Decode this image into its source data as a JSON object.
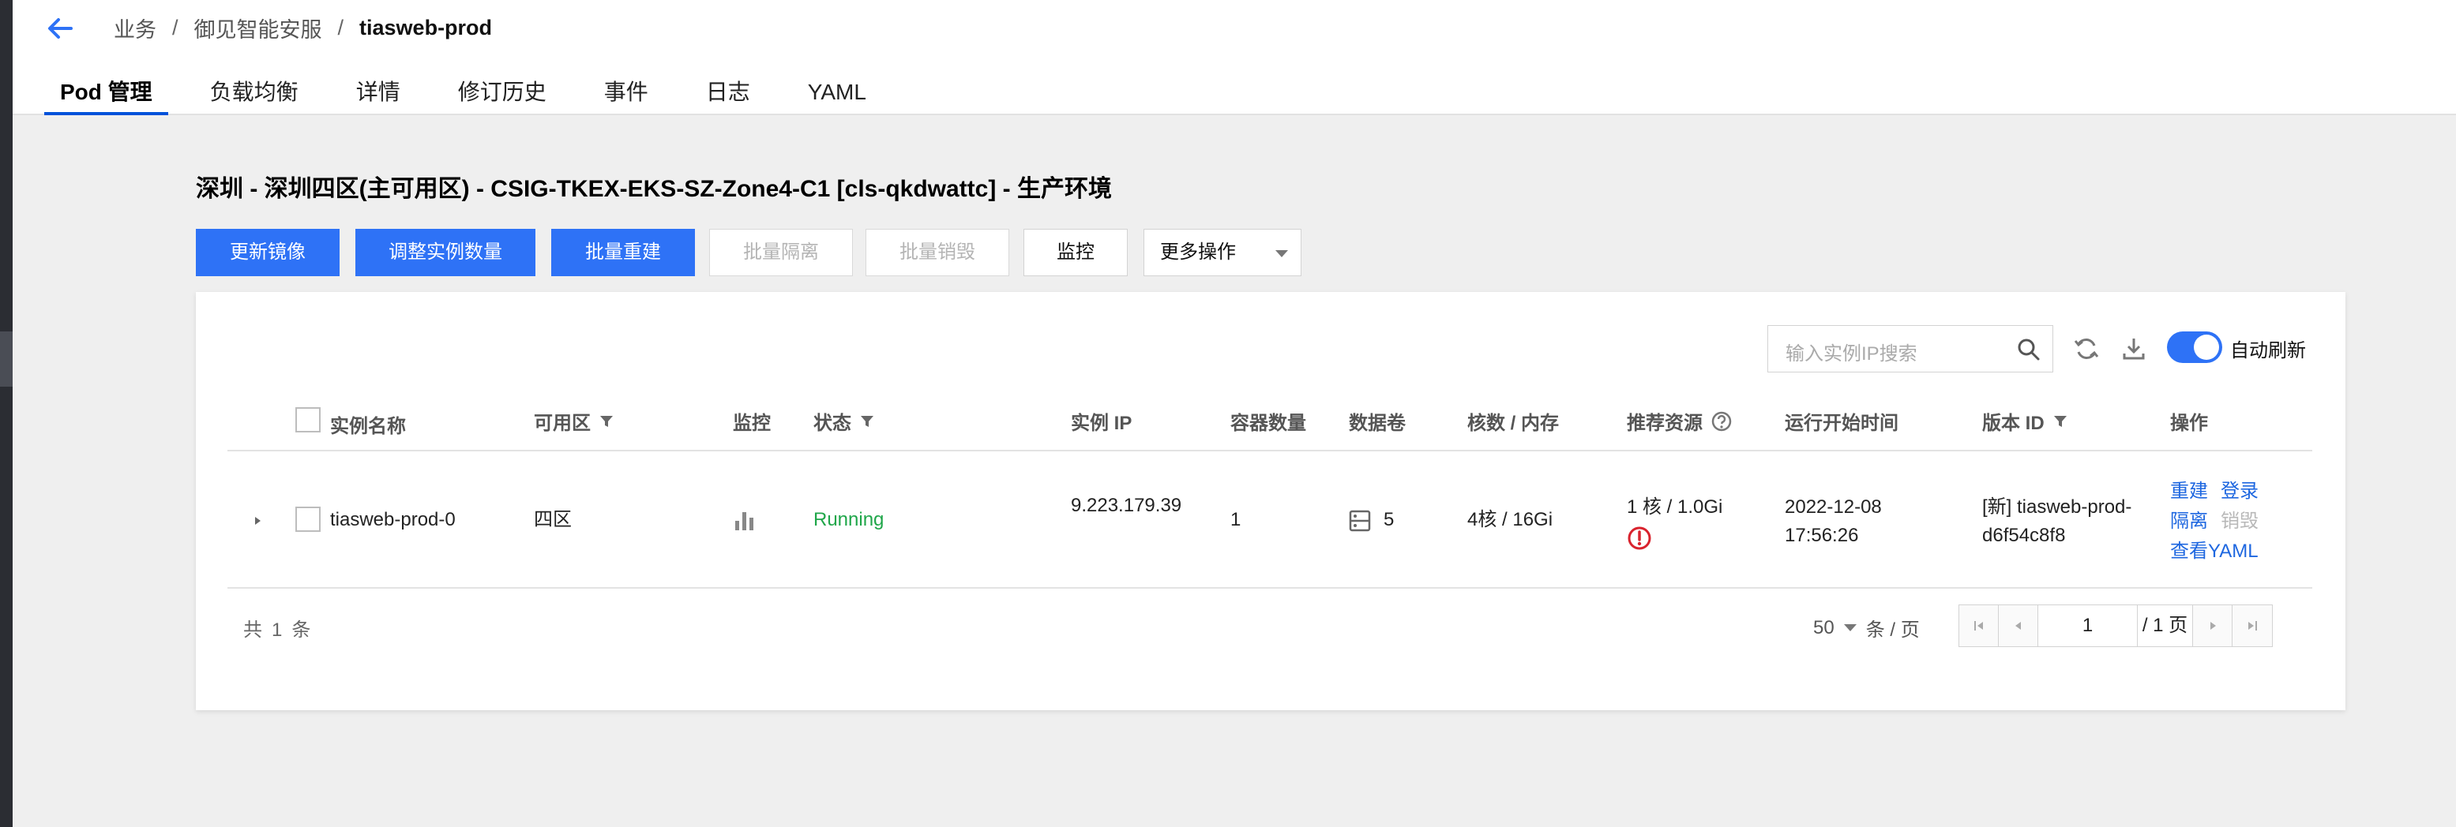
{
  "breadcrumb": {
    "root": "业务",
    "sep": "/",
    "business": "御见智能安服",
    "current": "tiasweb-prod"
  },
  "tabs": [
    {
      "label": "Pod 管理",
      "active": true
    },
    {
      "label": "负载均衡"
    },
    {
      "label": "详情"
    },
    {
      "label": "修订历史"
    },
    {
      "label": "事件"
    },
    {
      "label": "日志"
    },
    {
      "label": "YAML"
    }
  ],
  "cluster_title": "深圳 - 深圳四区(主可用区) - CSIG-TKEX-EKS-SZ-Zone4-C1 [cls-qkdwattc] - 生产环境",
  "toolbar": {
    "update_image": "更新镜像",
    "adjust_instances": "调整实例数量",
    "batch_rebuild": "批量重建",
    "batch_isolate": "批量隔离",
    "batch_destroy": "批量销毁",
    "monitor": "监控",
    "more_actions": "更多操作"
  },
  "search": {
    "placeholder": "输入实例IP搜索"
  },
  "auto_refresh": {
    "label": "自动刷新",
    "enabled": true
  },
  "table": {
    "headers": {
      "name": "实例名称",
      "zone": "可用区",
      "monitor": "监控",
      "status": "状态",
      "ip": "实例 IP",
      "containers": "容器数量",
      "volumes": "数据卷",
      "cpu_mem": "核数 / 内存",
      "recommended": "推荐资源",
      "start_time": "运行开始时间",
      "version": "版本 ID",
      "actions": "操作"
    },
    "rows": [
      {
        "name": "tiasweb-prod-0",
        "zone": "四区",
        "status": "Running",
        "ip": "9.223.179.39",
        "containers": "1",
        "volumes": "5",
        "cpu_mem": "4核 / 16Gi",
        "recommended": "1 核 / 1.0Gi",
        "start_date": "2022-12-08",
        "start_clock": "17:56:26",
        "version_line1": "[新] tiasweb-prod-",
        "version_line2": "d6f54c8f8",
        "actions": {
          "rebuild": "重建",
          "login": "登录",
          "isolate": "隔离",
          "destroy": "销毁",
          "view_yaml": "查看YAML"
        }
      }
    ]
  },
  "pagination": {
    "total_prefix": "共",
    "total_count": "1",
    "total_suffix": "条",
    "page_size": "50",
    "page_size_unit": "条 / 页",
    "current_page": "1",
    "total_pages_text": "/ 1 页"
  },
  "colors": {
    "primary": "#2e72f6",
    "running": "#1fa649",
    "link": "#1e67e0",
    "warning": "#d9232e"
  }
}
